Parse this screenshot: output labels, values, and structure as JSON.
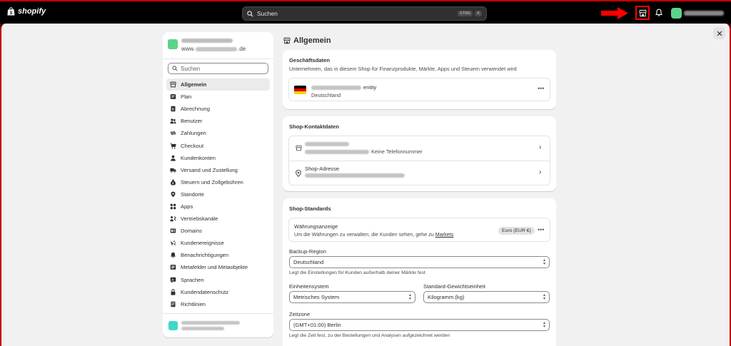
{
  "topbar": {
    "brand": "shopify",
    "search_placeholder": "Suchen",
    "shortcut_key1": "STRG",
    "shortcut_key2": "K"
  },
  "sidebar": {
    "store_url_suffix": ".de",
    "store_url_prefix": "www.",
    "search_placeholder": "Suchen",
    "items": [
      {
        "label": "Allgemein",
        "icon": "store-icon",
        "active": true
      },
      {
        "label": "Plan",
        "icon": "plan-icon"
      },
      {
        "label": "Abrechnung",
        "icon": "billing-icon"
      },
      {
        "label": "Benutzer",
        "icon": "users-icon"
      },
      {
        "label": "Zahlungen",
        "icon": "payments-icon"
      },
      {
        "label": "Checkout",
        "icon": "cart-icon"
      },
      {
        "label": "Kundenkonten",
        "icon": "person-icon"
      },
      {
        "label": "Versand und Zustellung",
        "icon": "truck-icon"
      },
      {
        "label": "Steuern und Zollgebühren",
        "icon": "tax-icon"
      },
      {
        "label": "Standorte",
        "icon": "location-icon"
      },
      {
        "label": "Apps",
        "icon": "apps-icon"
      },
      {
        "label": "Vertriebskanäle",
        "icon": "channels-icon"
      },
      {
        "label": "Domains",
        "icon": "globe-icon"
      },
      {
        "label": "Kundenereignisse",
        "icon": "events-icon"
      },
      {
        "label": "Benachrichtigungen",
        "icon": "bell-icon"
      },
      {
        "label": "Metafelder und Metaobjekte",
        "icon": "metafields-icon"
      },
      {
        "label": "Sprachen",
        "icon": "languages-icon"
      },
      {
        "label": "Kundendatenschutz",
        "icon": "lock-icon"
      },
      {
        "label": "Richtlinien",
        "icon": "policies-icon"
      }
    ]
  },
  "main": {
    "title": "Allgemein",
    "business": {
      "title": "Geschäftsdaten",
      "subtitle": "Unternehmen, das in diesem Shop für Finanzprodukte, Märkte, Apps und Steuern verwendet wird",
      "entity_suffix": "entity",
      "country": "Deutschland"
    },
    "contact": {
      "title": "Shop-Kontaktdaten",
      "phone_note": "Keine Telefonnummer",
      "address_label": "Shop-Adresse"
    },
    "standards": {
      "title": "Shop-Standards",
      "currency_label": "Währungsanzeige",
      "currency_hint": "Um die Währungen zu verwalten, die Kunden sehen, gehe zu",
      "currency_link": "Markets",
      "currency_badge": "Euro (EUR €)",
      "backup_label": "Backup-Region",
      "backup_value": "Deutschland",
      "backup_hint": "Legt die Einstellungen für Kunden außerhalb deiner Märkte fest",
      "unit_label": "Einheitensystem",
      "unit_value": "Metrisches System",
      "weight_label": "Standard-Gewichtseinheit",
      "weight_value": "Kilogramm (kg)",
      "tz_label": "Zeitzone",
      "tz_value": "(GMT+01:00) Berlin",
      "tz_hint": "Legt die Zeit fest, zu der Bestellungen und Analysen aufgezeichnet werden"
    }
  },
  "colors": {
    "accent_red": "#ff0000",
    "avatar_green": "#5bd48a",
    "store_teal": "#3fd8c8"
  }
}
